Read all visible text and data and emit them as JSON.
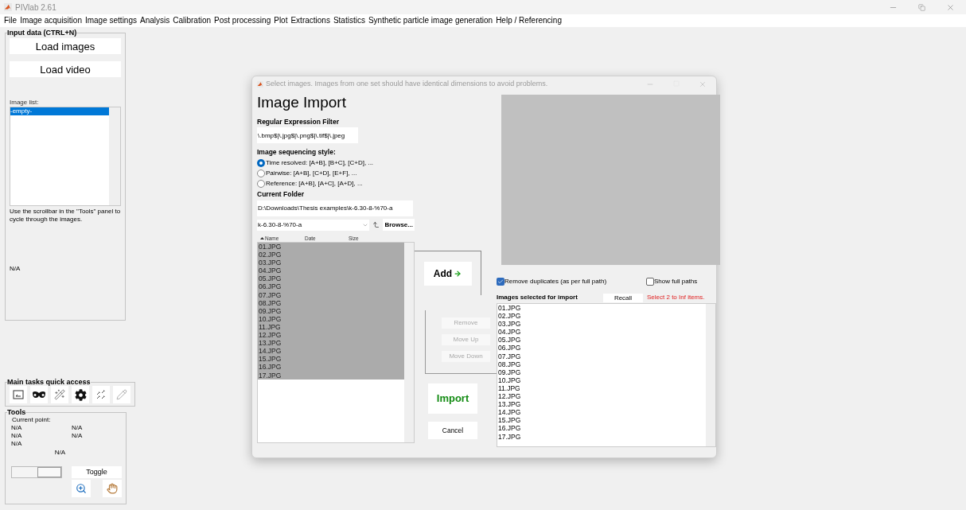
{
  "window": {
    "title": "PIVlab 2.61"
  },
  "menu": [
    "File",
    "Image acquisition",
    "Image settings",
    "Analysis",
    "Calibration",
    "Post processing",
    "Plot",
    "Extractions",
    "Statistics",
    "Synthetic particle image generation",
    "Help / Referencing"
  ],
  "input_panel": {
    "title": "Input data (CTRL+N)",
    "buttons": [
      "Load images",
      "Load video"
    ],
    "image_list_label": "Image list:",
    "image_list": [
      {
        "label": "-empty-",
        "selected": true
      }
    ],
    "hint": "Use the scrollbar in the \"Tools\" panel to cycle through the images.",
    "status": "N/A"
  },
  "quick_access": {
    "title": "Main tasks quick access"
  },
  "tools": {
    "title": "Tools",
    "current_point_label": "Current point:",
    "readouts": [
      "N/A",
      "N/A",
      "N/A",
      "N/A",
      "N/A"
    ],
    "center_readout": "N/A",
    "slider": {
      "level": 1
    },
    "toggle_button": "Toggle"
  },
  "dialog": {
    "title": "Select images. Images from one set should have identical dimensions to avoid problems.",
    "heading": "Image Import",
    "regex": {
      "label": "Regular Expression Filter",
      "value": "\\.bmp$|\\.jpg$|\\.png$|\\.tif$|\\.jpeg"
    },
    "sequencing": {
      "label": "Image sequencing style:",
      "options": [
        {
          "label": "Time resolved: [A+B], [B+C], [C+D], ...",
          "selected": true
        },
        {
          "label": "Pairwise: [A+B], [C+D], [E+F], ...",
          "selected": false
        },
        {
          "label": "Reference: [A+B], [A+C], [A+D], ...",
          "selected": false
        }
      ]
    },
    "folder": {
      "label": "Current Folder",
      "path": "D:\\Downloads\\Thesis examples\\k-6.30-8-%70-a",
      "dropdown_value": "k-6.30-8-%70-a",
      "browse_button": "Browse..."
    },
    "file_list": {
      "columns": [
        "Name",
        "Date",
        "Size"
      ],
      "rows": [
        {
          "name": "01.JPG",
          "selected": true
        },
        {
          "name": "02.JPG",
          "selected": true
        },
        {
          "name": "03.JPG",
          "selected": true
        },
        {
          "name": "04.JPG",
          "selected": true
        },
        {
          "name": "05.JPG",
          "selected": true
        },
        {
          "name": "06.JPG",
          "selected": true
        },
        {
          "name": "07.JPG",
          "selected": true
        },
        {
          "name": "08.JPG",
          "selected": true
        },
        {
          "name": "09.JPG",
          "selected": true
        },
        {
          "name": "10.JPG",
          "selected": true
        },
        {
          "name": "11.JPG",
          "selected": true
        },
        {
          "name": "12.JPG",
          "selected": true
        },
        {
          "name": "13.JPG",
          "selected": true
        },
        {
          "name": "14.JPG",
          "selected": true
        },
        {
          "name": "15.JPG",
          "selected": true
        },
        {
          "name": "16.JPG",
          "selected": true
        },
        {
          "name": "17.JPG",
          "selected": true
        }
      ]
    },
    "add_button": "Add",
    "edit_buttons": [
      {
        "label": "Remove",
        "disabled": true
      },
      {
        "label": "Move Up",
        "disabled": true
      },
      {
        "label": "Move Down",
        "disabled": true
      }
    ],
    "import_button": "Import",
    "cancel_button": "Cancel",
    "options": [
      {
        "label": "Remove duplicates (as per full path)",
        "checked": true
      },
      {
        "label": "Show full paths",
        "checked": false
      }
    ],
    "selected_label": "Images selected for import",
    "recall_button": "Recall",
    "message": "Select 2 to Inf items.",
    "selected_list": [
      "01.JPG",
      "02.JPG",
      "03.JPG",
      "04.JPG",
      "05.JPG",
      "06.JPG",
      "07.JPG",
      "08.JPG",
      "09.JPG",
      "10.JPG",
      "11.JPG",
      "12.JPG",
      "13.JPG",
      "14.JPG",
      "15.JPG",
      "16.JPG",
      "17.JPG"
    ]
  }
}
